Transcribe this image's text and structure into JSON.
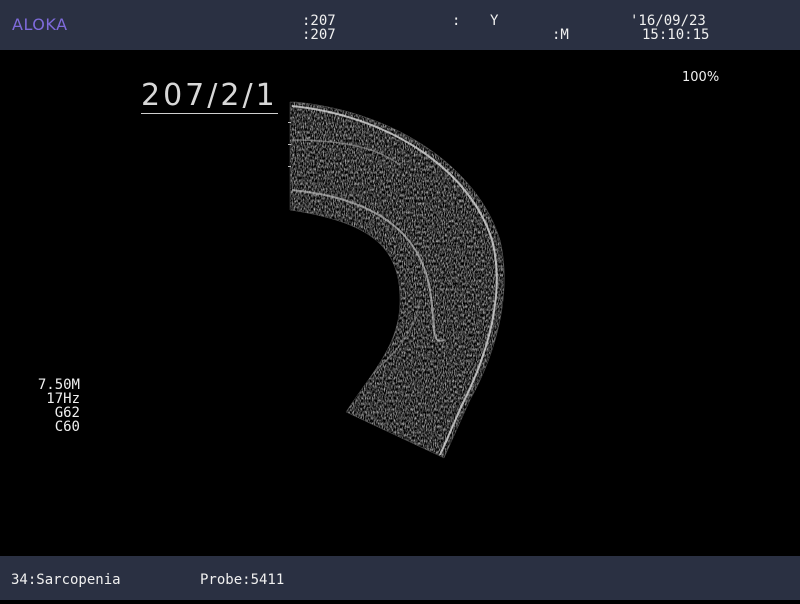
{
  "header": {
    "brand": "ALOKA",
    "id_line1": ":207",
    "id_line2": ":207",
    "field_colon": ":",
    "age_unit": "Y",
    "sex_label": ":M",
    "date": "'16/09/23",
    "time": "15:10:15"
  },
  "image_annotation": "207/2/1",
  "zoom_level": "100%",
  "scan_parameters": {
    "frequency": "7.50M",
    "frame_rate": "17Hz",
    "gain": "G62",
    "contrast": "C60"
  },
  "footer": {
    "preset": "34:Sarcopenia",
    "probe": "Probe:5411"
  },
  "colors": {
    "bar_background": "#2a3042",
    "brand": "#7f6bdc",
    "image_background": "#000000"
  }
}
